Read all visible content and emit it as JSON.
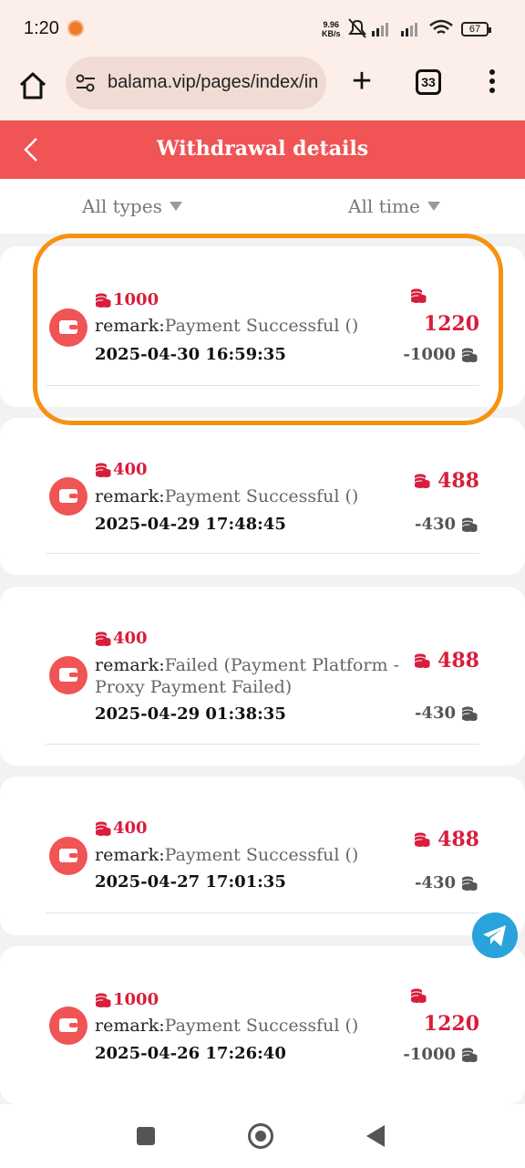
{
  "status_bar": {
    "time": "1:20",
    "net_speed_value": "9.96",
    "net_speed_unit": "KB/s",
    "battery": "67"
  },
  "browser": {
    "url": "balama.vip/pages/index/inc",
    "tab_count": "33"
  },
  "header": {
    "title": "Withdrawal details"
  },
  "filters": {
    "type_label": "All types",
    "time_label": "All time"
  },
  "remark_label": "remark:",
  "records": [
    {
      "amount": "1000",
      "remark": "Payment Successful ()",
      "date": "2025-04-30 16:59:35",
      "balance": "1220",
      "change": "-1000"
    },
    {
      "amount": "400",
      "remark": "Payment Successful ()",
      "date": "2025-04-29 17:48:45",
      "balance": "488",
      "change": "-430"
    },
    {
      "amount": "400",
      "remark": "Failed (Payment Platform - Proxy Payment Failed)",
      "date": "2025-04-29 01:38:35",
      "balance": "488",
      "change": "-430"
    },
    {
      "amount": "400",
      "remark": "Payment Successful ()",
      "date": "2025-04-27 17:01:35",
      "balance": "488",
      "change": "-430"
    },
    {
      "amount": "1000",
      "remark": "Payment Successful ()",
      "date": "2025-04-26 17:26:40",
      "balance": "1220",
      "change": "-1000"
    }
  ],
  "colors": {
    "accent": "#f05454",
    "amount": "#d81e3c",
    "highlight": "#f7910f"
  }
}
